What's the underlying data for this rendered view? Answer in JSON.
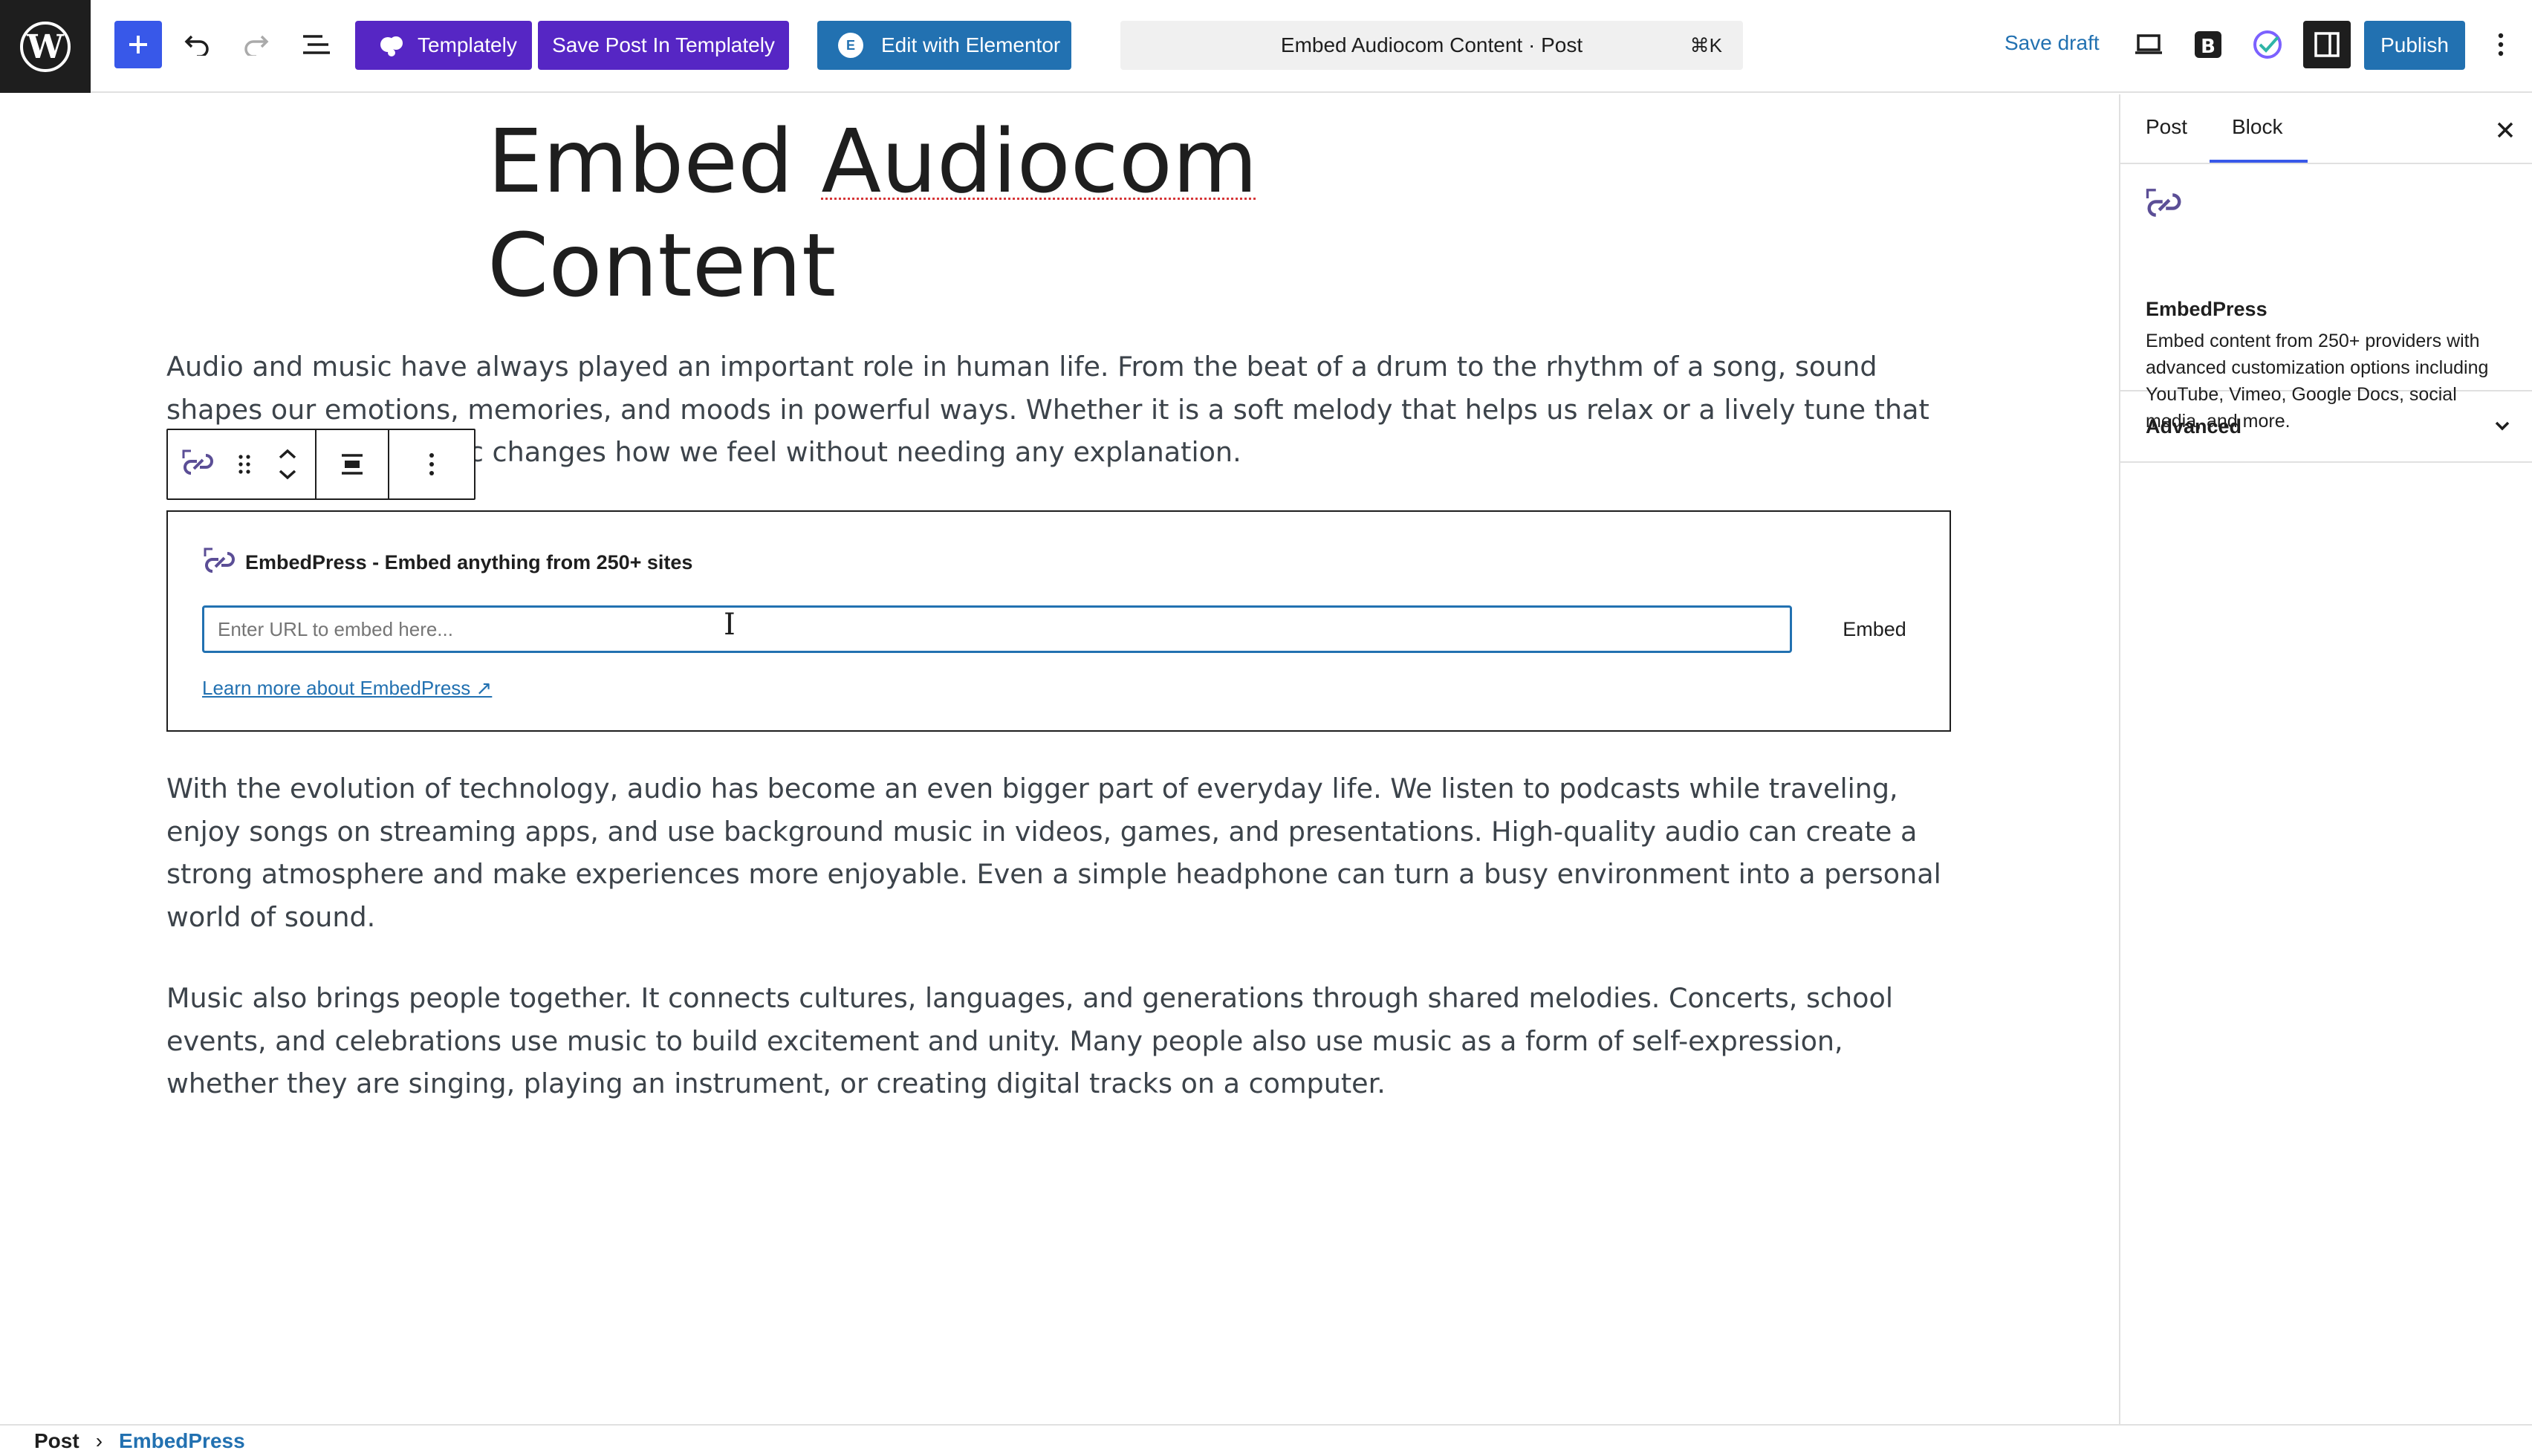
{
  "toolbar": {
    "templately_label": "Templately",
    "save_templately_label": "Save Post In Templately",
    "elementor_label": "Edit with Elementor",
    "command_bar_text": "Embed Audiocom Content · Post",
    "command_shortcut": "⌘K",
    "save_draft_label": "Save draft",
    "publish_label": "Publish",
    "accent_color": "#3858e9",
    "templately_color": "#5626c4",
    "primary_color": "#2271b1"
  },
  "post": {
    "title_line1_a": "Embed",
    "title_line1_b": "Audiocom",
    "title_line2": "Content",
    "para1": "Audio and music have always played an important role in human life. From the beat of a drum to the rhythm of a song, sound shapes our emotions, memories, and moods in powerful ways. Whether it is a soft melody that helps us relax or a lively tune that makes us dance, music changes how we feel without needing any explanation.",
    "para2": "With the evolution of technology, audio has become an even bigger part of everyday life. We listen to podcasts while traveling, enjoy songs on streaming apps, and use background music in videos, games, and presentations. High-quality audio can create a strong atmosphere and make experiences more enjoyable. Even a simple headphone can turn a busy environment into a personal world of sound.",
    "para3": "Music also brings people together. It connects cultures, languages, and generations through shared melodies. Concerts, school events, and celebrations use music to build excitement and unity. Many people also use music as a form of self-expression, whether they are singing, playing an instrument, or creating digital tracks on a computer."
  },
  "embed_block": {
    "heading": "EmbedPress - Embed anything from 250+ sites",
    "input_placeholder": "Enter URL to embed here...",
    "input_value": "",
    "embed_button": "Embed",
    "learn_more": "Learn more about EmbedPress ↗"
  },
  "sidebar": {
    "tab_post": "Post",
    "tab_block": "Block",
    "active_tab": "Block",
    "block_name": "EmbedPress",
    "block_description": "Embed content from 250+ providers with advanced customization options including YouTube, Vimeo, Google Docs, social media, and more.",
    "advanced_label": "Advanced"
  },
  "breadcrumb": {
    "root": "Post",
    "separator": "›",
    "current": "EmbedPress"
  }
}
